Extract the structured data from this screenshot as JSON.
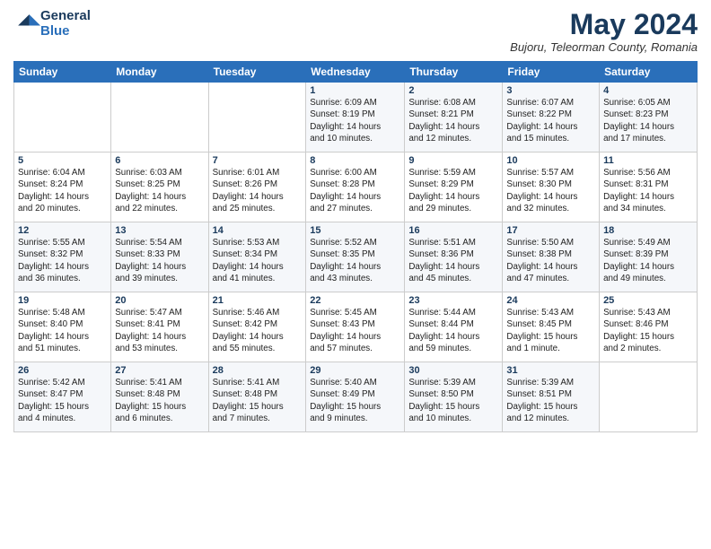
{
  "header": {
    "logo_general": "General",
    "logo_blue": "Blue",
    "month_title": "May 2024",
    "location": "Bujoru, Teleorman County, Romania"
  },
  "days_of_week": [
    "Sunday",
    "Monday",
    "Tuesday",
    "Wednesday",
    "Thursday",
    "Friday",
    "Saturday"
  ],
  "weeks": [
    [
      {
        "num": "",
        "info": ""
      },
      {
        "num": "",
        "info": ""
      },
      {
        "num": "",
        "info": ""
      },
      {
        "num": "1",
        "info": "Sunrise: 6:09 AM\nSunset: 8:19 PM\nDaylight: 14 hours\nand 10 minutes."
      },
      {
        "num": "2",
        "info": "Sunrise: 6:08 AM\nSunset: 8:21 PM\nDaylight: 14 hours\nand 12 minutes."
      },
      {
        "num": "3",
        "info": "Sunrise: 6:07 AM\nSunset: 8:22 PM\nDaylight: 14 hours\nand 15 minutes."
      },
      {
        "num": "4",
        "info": "Sunrise: 6:05 AM\nSunset: 8:23 PM\nDaylight: 14 hours\nand 17 minutes."
      }
    ],
    [
      {
        "num": "5",
        "info": "Sunrise: 6:04 AM\nSunset: 8:24 PM\nDaylight: 14 hours\nand 20 minutes."
      },
      {
        "num": "6",
        "info": "Sunrise: 6:03 AM\nSunset: 8:25 PM\nDaylight: 14 hours\nand 22 minutes."
      },
      {
        "num": "7",
        "info": "Sunrise: 6:01 AM\nSunset: 8:26 PM\nDaylight: 14 hours\nand 25 minutes."
      },
      {
        "num": "8",
        "info": "Sunrise: 6:00 AM\nSunset: 8:28 PM\nDaylight: 14 hours\nand 27 minutes."
      },
      {
        "num": "9",
        "info": "Sunrise: 5:59 AM\nSunset: 8:29 PM\nDaylight: 14 hours\nand 29 minutes."
      },
      {
        "num": "10",
        "info": "Sunrise: 5:57 AM\nSunset: 8:30 PM\nDaylight: 14 hours\nand 32 minutes."
      },
      {
        "num": "11",
        "info": "Sunrise: 5:56 AM\nSunset: 8:31 PM\nDaylight: 14 hours\nand 34 minutes."
      }
    ],
    [
      {
        "num": "12",
        "info": "Sunrise: 5:55 AM\nSunset: 8:32 PM\nDaylight: 14 hours\nand 36 minutes."
      },
      {
        "num": "13",
        "info": "Sunrise: 5:54 AM\nSunset: 8:33 PM\nDaylight: 14 hours\nand 39 minutes."
      },
      {
        "num": "14",
        "info": "Sunrise: 5:53 AM\nSunset: 8:34 PM\nDaylight: 14 hours\nand 41 minutes."
      },
      {
        "num": "15",
        "info": "Sunrise: 5:52 AM\nSunset: 8:35 PM\nDaylight: 14 hours\nand 43 minutes."
      },
      {
        "num": "16",
        "info": "Sunrise: 5:51 AM\nSunset: 8:36 PM\nDaylight: 14 hours\nand 45 minutes."
      },
      {
        "num": "17",
        "info": "Sunrise: 5:50 AM\nSunset: 8:38 PM\nDaylight: 14 hours\nand 47 minutes."
      },
      {
        "num": "18",
        "info": "Sunrise: 5:49 AM\nSunset: 8:39 PM\nDaylight: 14 hours\nand 49 minutes."
      }
    ],
    [
      {
        "num": "19",
        "info": "Sunrise: 5:48 AM\nSunset: 8:40 PM\nDaylight: 14 hours\nand 51 minutes."
      },
      {
        "num": "20",
        "info": "Sunrise: 5:47 AM\nSunset: 8:41 PM\nDaylight: 14 hours\nand 53 minutes."
      },
      {
        "num": "21",
        "info": "Sunrise: 5:46 AM\nSunset: 8:42 PM\nDaylight: 14 hours\nand 55 minutes."
      },
      {
        "num": "22",
        "info": "Sunrise: 5:45 AM\nSunset: 8:43 PM\nDaylight: 14 hours\nand 57 minutes."
      },
      {
        "num": "23",
        "info": "Sunrise: 5:44 AM\nSunset: 8:44 PM\nDaylight: 14 hours\nand 59 minutes."
      },
      {
        "num": "24",
        "info": "Sunrise: 5:43 AM\nSunset: 8:45 PM\nDaylight: 15 hours\nand 1 minute."
      },
      {
        "num": "25",
        "info": "Sunrise: 5:43 AM\nSunset: 8:46 PM\nDaylight: 15 hours\nand 2 minutes."
      }
    ],
    [
      {
        "num": "26",
        "info": "Sunrise: 5:42 AM\nSunset: 8:47 PM\nDaylight: 15 hours\nand 4 minutes."
      },
      {
        "num": "27",
        "info": "Sunrise: 5:41 AM\nSunset: 8:48 PM\nDaylight: 15 hours\nand 6 minutes."
      },
      {
        "num": "28",
        "info": "Sunrise: 5:41 AM\nSunset: 8:48 PM\nDaylight: 15 hours\nand 7 minutes."
      },
      {
        "num": "29",
        "info": "Sunrise: 5:40 AM\nSunset: 8:49 PM\nDaylight: 15 hours\nand 9 minutes."
      },
      {
        "num": "30",
        "info": "Sunrise: 5:39 AM\nSunset: 8:50 PM\nDaylight: 15 hours\nand 10 minutes."
      },
      {
        "num": "31",
        "info": "Sunrise: 5:39 AM\nSunset: 8:51 PM\nDaylight: 15 hours\nand 12 minutes."
      },
      {
        "num": "",
        "info": ""
      }
    ]
  ]
}
